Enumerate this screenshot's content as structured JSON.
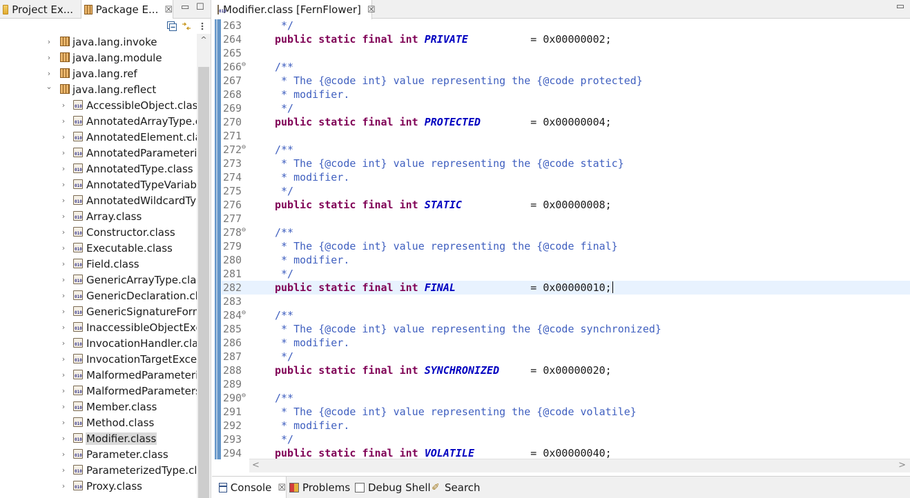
{
  "left_panel": {
    "tabs": [
      {
        "label": "Project Ex...",
        "icon": "project-explorer-icon",
        "active": false
      },
      {
        "label": "Package E...",
        "icon": "package-explorer-icon",
        "active": true
      }
    ],
    "close_glyph": "☒",
    "minimize_glyph": "▭",
    "maximize_glyph": "☐",
    "toolbar_icons": [
      "collapse-all-icon",
      "link-with-editor-icon",
      "view-menu-icon"
    ],
    "scroll_up_glyph": "^",
    "tree": [
      {
        "label": "java.lang.invoke",
        "kind": "package",
        "expanded": false
      },
      {
        "label": "java.lang.module",
        "kind": "package",
        "expanded": false
      },
      {
        "label": "java.lang.ref",
        "kind": "package",
        "expanded": false
      },
      {
        "label": "java.lang.reflect",
        "kind": "package",
        "expanded": true
      },
      {
        "label": "AccessibleObject.class",
        "kind": "class"
      },
      {
        "label": "AnnotatedArrayType.cla",
        "kind": "class"
      },
      {
        "label": "AnnotatedElement.class",
        "kind": "class"
      },
      {
        "label": "AnnotatedParameterize",
        "kind": "class"
      },
      {
        "label": "AnnotatedType.class",
        "kind": "class"
      },
      {
        "label": "AnnotatedTypeVariable",
        "kind": "class"
      },
      {
        "label": "AnnotatedWildcardType",
        "kind": "class"
      },
      {
        "label": "Array.class",
        "kind": "class"
      },
      {
        "label": "Constructor.class",
        "kind": "class"
      },
      {
        "label": "Executable.class",
        "kind": "class"
      },
      {
        "label": "Field.class",
        "kind": "class"
      },
      {
        "label": "GenericArrayType.class",
        "kind": "class"
      },
      {
        "label": "GenericDeclaration.clas",
        "kind": "class"
      },
      {
        "label": "GenericSignatureForma",
        "kind": "class"
      },
      {
        "label": "InaccessibleObjectExcep",
        "kind": "class"
      },
      {
        "label": "InvocationHandler.class",
        "kind": "class"
      },
      {
        "label": "InvocationTargetExcept",
        "kind": "class"
      },
      {
        "label": "MalformedParameterize",
        "kind": "class"
      },
      {
        "label": "MalformedParametersE",
        "kind": "class"
      },
      {
        "label": "Member.class",
        "kind": "class"
      },
      {
        "label": "Method.class",
        "kind": "class"
      },
      {
        "label": "Modifier.class",
        "kind": "class",
        "selected": true
      },
      {
        "label": "Parameter.class",
        "kind": "class"
      },
      {
        "label": "ParameterizedType.class",
        "kind": "class"
      },
      {
        "label": "Proxy.class",
        "kind": "class"
      }
    ]
  },
  "editor": {
    "tab_label": "Modifier.class [FernFlower]",
    "tab_icon": "class-file-icon",
    "close_glyph": "☒",
    "minimize_glyph": "▭",
    "current_line": 282,
    "lines": [
      {
        "n": "263",
        "fold": "",
        "text": "     */"
      },
      {
        "n": "264",
        "fold": "",
        "text": "    public static final int PRIVATE          = 0x00000002;"
      },
      {
        "n": "265",
        "fold": "",
        "text": ""
      },
      {
        "n": "266",
        "fold": "⊖",
        "text": "    /**"
      },
      {
        "n": "267",
        "fold": "",
        "text": "     * The {@code int} value representing the {@code protected}"
      },
      {
        "n": "268",
        "fold": "",
        "text": "     * modifier."
      },
      {
        "n": "269",
        "fold": "",
        "text": "     */"
      },
      {
        "n": "270",
        "fold": "",
        "text": "    public static final int PROTECTED        = 0x00000004;"
      },
      {
        "n": "271",
        "fold": "",
        "text": ""
      },
      {
        "n": "272",
        "fold": "⊖",
        "text": "    /**"
      },
      {
        "n": "273",
        "fold": "",
        "text": "     * The {@code int} value representing the {@code static}"
      },
      {
        "n": "274",
        "fold": "",
        "text": "     * modifier."
      },
      {
        "n": "275",
        "fold": "",
        "text": "     */"
      },
      {
        "n": "276",
        "fold": "",
        "text": "    public static final int STATIC           = 0x00000008;"
      },
      {
        "n": "277",
        "fold": "",
        "text": ""
      },
      {
        "n": "278",
        "fold": "⊖",
        "text": "    /**"
      },
      {
        "n": "279",
        "fold": "",
        "text": "     * The {@code int} value representing the {@code final}"
      },
      {
        "n": "280",
        "fold": "",
        "text": "     * modifier."
      },
      {
        "n": "281",
        "fold": "",
        "text": "     */"
      },
      {
        "n": "282",
        "fold": "",
        "text": "    public static final int FINAL            = 0x00000010;"
      },
      {
        "n": "283",
        "fold": "",
        "text": ""
      },
      {
        "n": "284",
        "fold": "⊖",
        "text": "    /**"
      },
      {
        "n": "285",
        "fold": "",
        "text": "     * The {@code int} value representing the {@code synchronized}"
      },
      {
        "n": "286",
        "fold": "",
        "text": "     * modifier."
      },
      {
        "n": "287",
        "fold": "",
        "text": "     */"
      },
      {
        "n": "288",
        "fold": "",
        "text": "    public static final int SYNCHRONIZED     = 0x00000020;"
      },
      {
        "n": "289",
        "fold": "",
        "text": ""
      },
      {
        "n": "290",
        "fold": "⊖",
        "text": "    /**"
      },
      {
        "n": "291",
        "fold": "",
        "text": "     * The {@code int} value representing the {@code volatile}"
      },
      {
        "n": "292",
        "fold": "",
        "text": "     * modifier."
      },
      {
        "n": "293",
        "fold": "",
        "text": "     */"
      },
      {
        "n": "294",
        "fold": "",
        "text": "    public static final int VOLATILE         = 0x00000040;"
      }
    ],
    "hscroll_left_glyph": "<",
    "hscroll_right_glyph": ">"
  },
  "bottom_tabs": [
    {
      "label": "Console",
      "icon": "console-icon",
      "active": true,
      "close": "☒"
    },
    {
      "label": "Problems",
      "icon": "problems-icon",
      "active": false
    },
    {
      "label": "Debug Shell",
      "icon": "debug-shell-icon",
      "active": false
    },
    {
      "label": "Search",
      "icon": "search-icon",
      "active": false
    }
  ],
  "colors": {
    "keyword": "#7f0055",
    "constant": "#0000c0",
    "javadoc": "#3f5fbf",
    "line_number": "#787878",
    "current_line_bg": "#e8f2fe",
    "selection_bg": "#dadada",
    "gutter_accent": "#6495c8"
  }
}
